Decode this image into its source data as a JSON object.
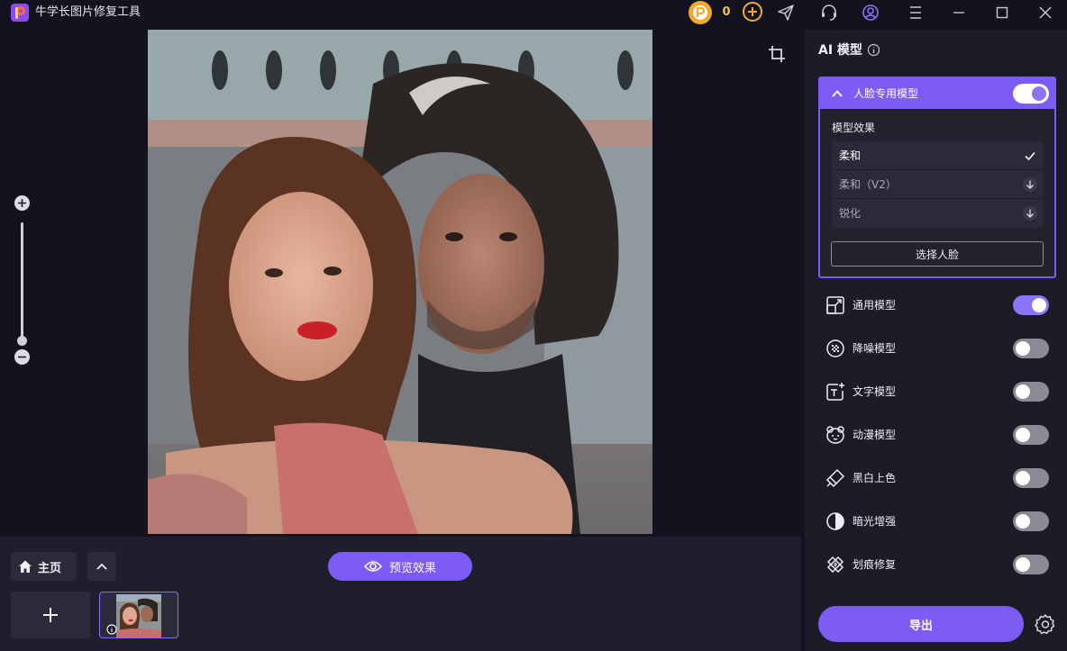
{
  "app": {
    "title": "牛学长图片修复工具"
  },
  "titlebar": {
    "coin_count": "0"
  },
  "bottom": {
    "home_label": "主页",
    "preview_label": "预览效果"
  },
  "panel": {
    "title": "AI 模型",
    "face_model": {
      "title": "人脸专用模型",
      "enabled": true,
      "effect_label": "模型效果",
      "effects": [
        {
          "label": "柔和",
          "state": "selected"
        },
        {
          "label": "柔和（V2）",
          "state": "download"
        },
        {
          "label": "锐化",
          "state": "download"
        }
      ],
      "choose_face_label": "选择人脸"
    },
    "models": [
      {
        "label": "通用模型",
        "icon": "upscale-icon",
        "enabled": true
      },
      {
        "label": "降噪模型",
        "icon": "denoise-icon",
        "enabled": false
      },
      {
        "label": "文字模型",
        "icon": "text-icon",
        "enabled": false
      },
      {
        "label": "动漫模型",
        "icon": "anime-icon",
        "enabled": false
      },
      {
        "label": "黑白上色",
        "icon": "colorize-icon",
        "enabled": false
      },
      {
        "label": "暗光增强",
        "icon": "lowlight-icon",
        "enabled": false
      },
      {
        "label": "划痕修复",
        "icon": "scratch-icon",
        "enabled": false
      }
    ],
    "export_label": "导出"
  },
  "colors": {
    "accent": "#7c5cf5",
    "background": "#131320",
    "panel": "#1c1c29",
    "coin": "#f3a92b"
  }
}
